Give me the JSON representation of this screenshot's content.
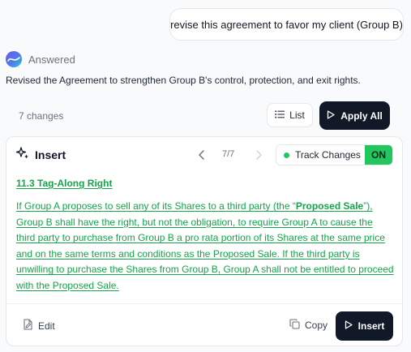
{
  "user_message": "revise this agreement to favor my client (Group B)",
  "status": {
    "label": "Answered",
    "icon": "assistant-logo-icon"
  },
  "summary": "Revised the Agreement to strengthen Group B's control, protection, and exit rights.",
  "toolbar": {
    "changes_count": "7 changes",
    "list_label": "List",
    "apply_all_label": "Apply All"
  },
  "card": {
    "title": "Insert",
    "pager": "7/7",
    "track_changes_label": "Track Changes",
    "track_changes_state": "ON",
    "section_title": "11.3 Tag-Along Right",
    "text_before": "If Group A proposes to sell any of its Shares to a third party (the “",
    "text_bold": "Proposed Sale",
    "text_after": "”), Group B shall have the right, but not the obligation, to require Group A to cause the third party to purchase from Group B a pro rata portion of its Shares at the same price and on the same terms and conditions as the Proposed Sale. If the third party is unwilling to purchase the Shares from Group B, Group A shall not be entitled to proceed with the Proposed Sale.",
    "edit_label": "Edit",
    "copy_label": "Copy",
    "insert_label": "Insert"
  },
  "colors": {
    "accent_green": "#16a34a",
    "toggle_green": "#22c55e",
    "dark_button": "#111827"
  }
}
